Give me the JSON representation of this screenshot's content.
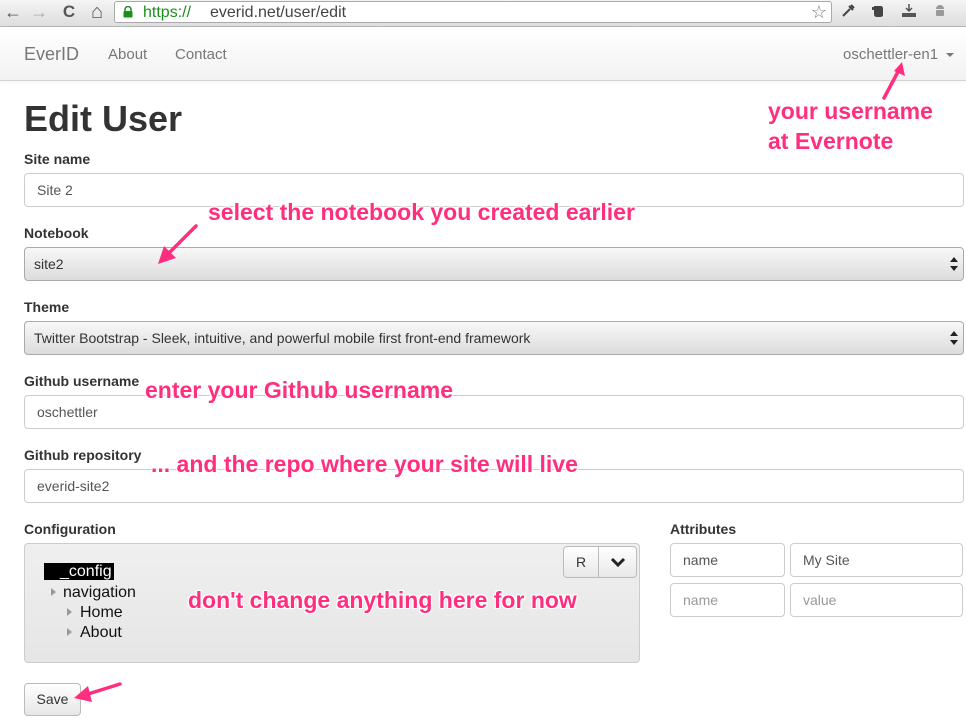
{
  "browser": {
    "url_scheme": "https://",
    "url_rest": "everid.net/user/edit",
    "back_glyph": "←",
    "forward_glyph": "→",
    "reload_glyph": "C",
    "home_glyph": "⌂",
    "star_glyph": "☆"
  },
  "navbar": {
    "brand": "EverID",
    "links": [
      "About",
      "Contact"
    ],
    "user": "oschettler-en1"
  },
  "page": {
    "title": "Edit User"
  },
  "form": {
    "site_name": {
      "label": "Site name",
      "value": "Site 2"
    },
    "notebook": {
      "label": "Notebook",
      "selected": "site2"
    },
    "theme": {
      "label": "Theme",
      "selected": "Twitter Bootstrap - Sleek, intuitive, and powerful mobile first front-end framework"
    },
    "github_username": {
      "label": "Github username",
      "value": "oschettler"
    },
    "github_repository": {
      "label": "Github repository",
      "value": "everid-site2"
    },
    "configuration": {
      "label": "Configuration",
      "r_button": "R",
      "tree": [
        "_config",
        "navigation",
        "Home",
        "About"
      ]
    },
    "attributes": {
      "label": "Attributes",
      "rows": [
        {
          "name": "name",
          "value": "My Site"
        },
        {
          "name_placeholder": "name",
          "value_placeholder": "value"
        }
      ]
    },
    "save_label": "Save"
  },
  "annotations": {
    "username_line1": "your username",
    "username_line2": "at Evernote",
    "notebook": "select the notebook you created earlier",
    "github_user": "enter your Github username",
    "repo": "... and the repo where your site will live",
    "config": "don't change anything here for now"
  },
  "colors": {
    "annotation": "#ff2e7e",
    "url_secure": "#1a8f1a"
  }
}
